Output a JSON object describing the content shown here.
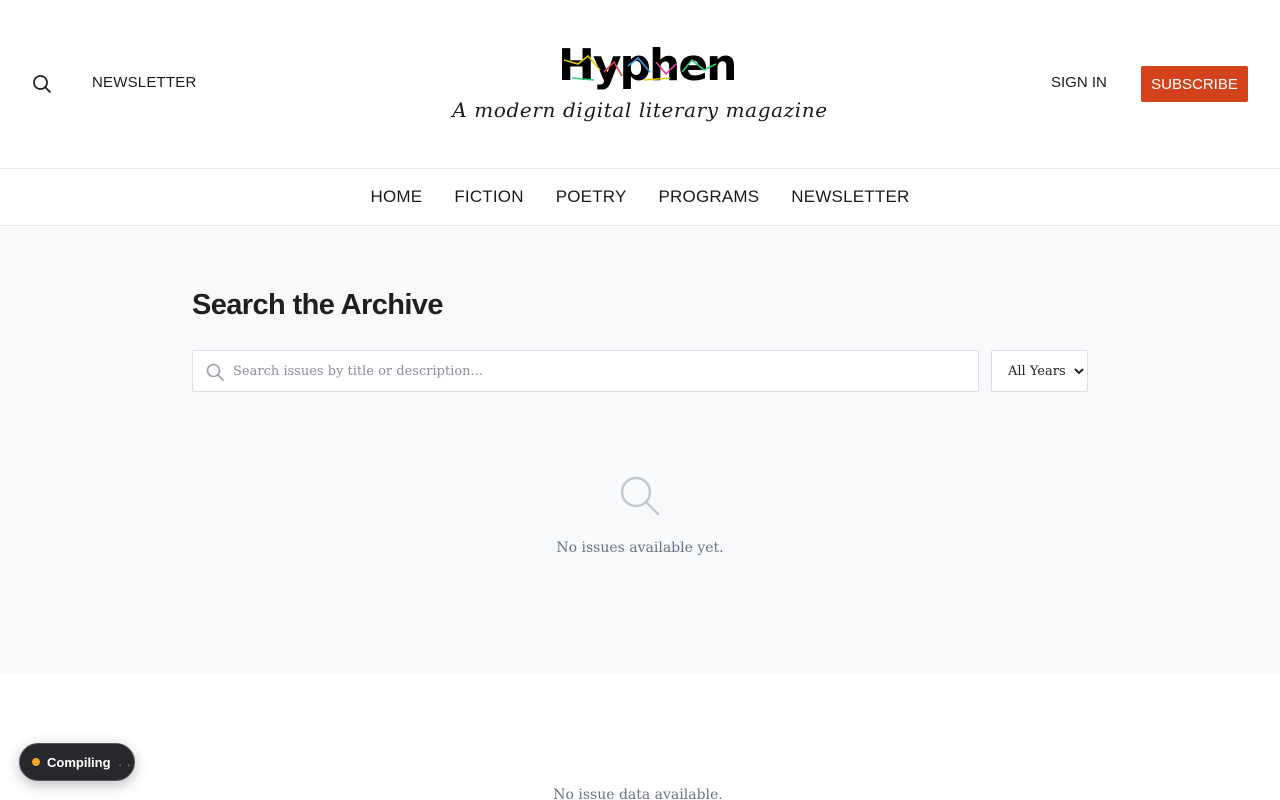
{
  "header": {
    "newsletter_label": "NEWSLETTER",
    "logo_text": "Hyphen",
    "tagline": "A modern digital literary magazine",
    "signin_label": "SIGN IN",
    "subscribe_label": "SUBSCRIBE"
  },
  "nav": {
    "items": [
      {
        "label": "HOME"
      },
      {
        "label": "FICTION"
      },
      {
        "label": "POETRY"
      },
      {
        "label": "PROGRAMS"
      },
      {
        "label": "NEWSLETTER"
      }
    ]
  },
  "archive": {
    "title": "Search the Archive",
    "search_placeholder": "Search issues by title or description...",
    "year_selected": "All Years",
    "empty_message": "No issues available yet."
  },
  "lower": {
    "message": "No issue data available."
  },
  "status_pill": {
    "label": "Compiling",
    "dots": ". ."
  },
  "colors": {
    "accent": "#d4421c",
    "main_bg": "#f8f9fb",
    "status_dot": "#f5a623"
  },
  "icons": {
    "header_search": "search-icon",
    "input_search": "search-icon",
    "empty_state": "search-icon"
  }
}
